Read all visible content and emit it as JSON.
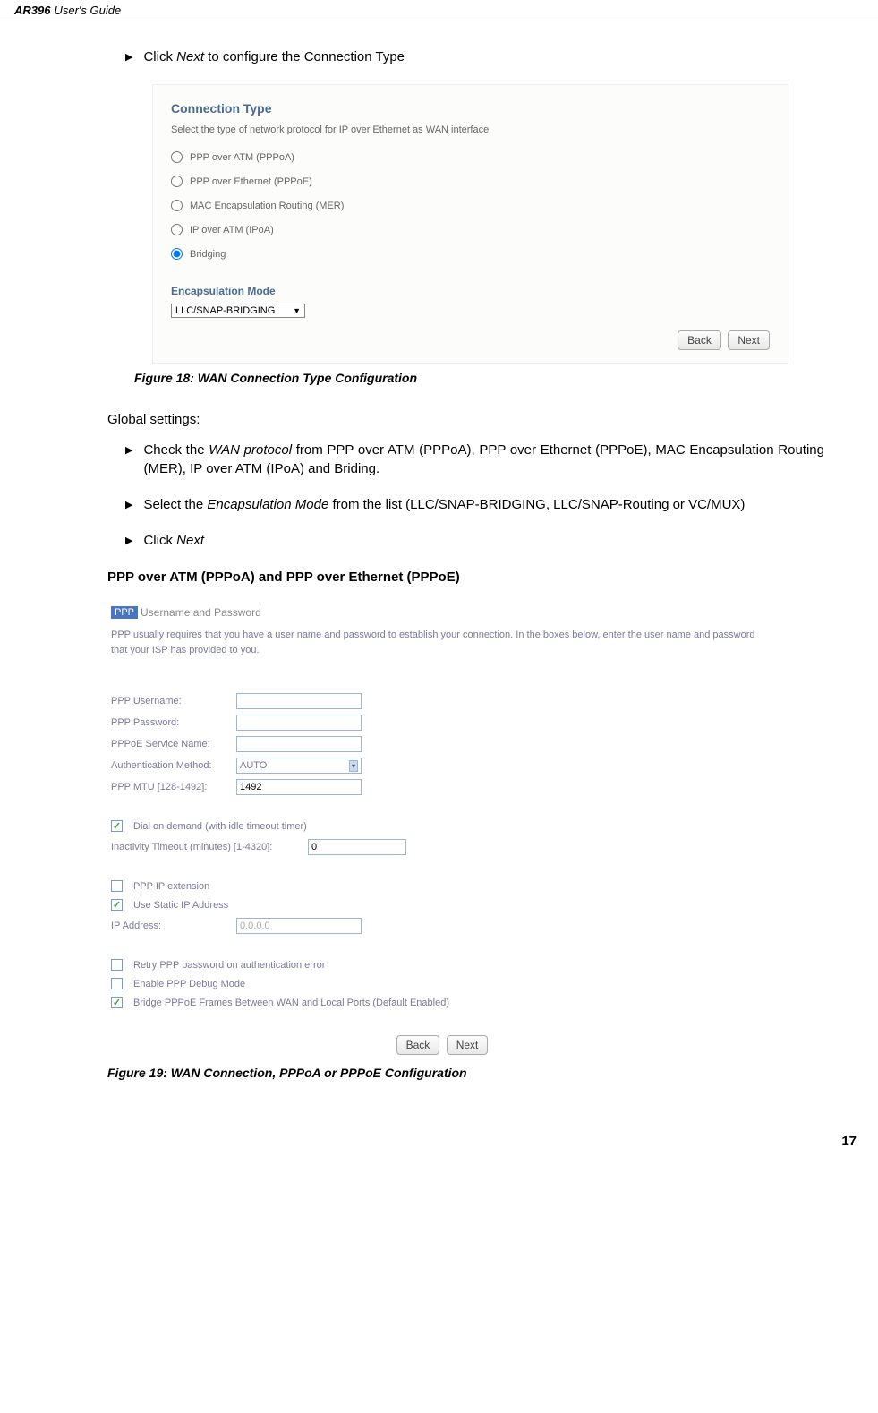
{
  "header": {
    "model": "AR396",
    "guide": "User's Guide"
  },
  "intro_bullet": {
    "prefix": "Click ",
    "italic": "Next",
    "suffix": " to configure the Connection Type"
  },
  "fig18": {
    "box": {
      "title": "Connection Type",
      "desc": "Select the type of network protocol for IP over Ethernet as WAN interface",
      "radios": [
        "PPP over ATM (PPPoA)",
        "PPP over Ethernet (PPPoE)",
        "MAC Encapsulation Routing (MER)",
        "IP over ATM (IPoA)",
        "Bridging"
      ],
      "encap_title": "Encapsulation Mode",
      "encap_value": "LLC/SNAP-BRIDGING",
      "back": "Back",
      "next": "Next"
    },
    "caption": "Figure 18: WAN Connection Type Configuration"
  },
  "global": {
    "heading": "Global settings:",
    "b1_a": "Check the ",
    "b1_b": "WAN protocol",
    "b1_c": " from PPP over ATM (PPPoA), PPP over Ethernet (PPPoE), MAC Encapsulation Routing (MER), IP over ATM (IPoA) and Briding.",
    "b2_a": "Select the ",
    "b2_b": "Encapsulation Mode",
    "b2_c": " from the list (LLC/SNAP-BRIDGING, LLC/SNAP-Routing or VC/MUX)",
    "b3_a": "Click ",
    "b3_b": "Next"
  },
  "ppp_heading": "PPP over ATM (PPPoA) and PPP over Ethernet (PPPoE)",
  "fig19": {
    "box": {
      "badge": "PPP",
      "title_rest": "Username and Password",
      "desc": "PPP usually requires that you have a user name and password to establish your connection. In the boxes below, enter the user name and password that your ISP has provided to you.",
      "labels": {
        "username": "PPP Username:",
        "password": "PPP Password:",
        "service": "PPPoE Service Name:",
        "auth": "Authentication Method:",
        "mtu": "PPP MTU [128-1492]:",
        "inactivity": "Inactivity Timeout (minutes) [1-4320]:",
        "ipaddress": "IP Address:"
      },
      "values": {
        "auth": "AUTO",
        "mtu": "1492",
        "inactivity": "0",
        "ipaddress": "0.0.0.0"
      },
      "checkboxes": {
        "dial_on_demand": "Dial on demand (with idle timeout timer)",
        "ppp_ip_ext": "PPP IP extension",
        "static_ip": "Use Static IP Address",
        "retry_ppp": "Retry PPP password on authentication error",
        "debug": "Enable PPP Debug Mode",
        "bridge": "Bridge PPPoE Frames Between WAN and Local Ports (Default Enabled)"
      },
      "back": "Back",
      "next": "Next"
    },
    "caption": "Figure 19: WAN Connection, PPPoA or PPPoE Configuration"
  },
  "page_number": "17"
}
